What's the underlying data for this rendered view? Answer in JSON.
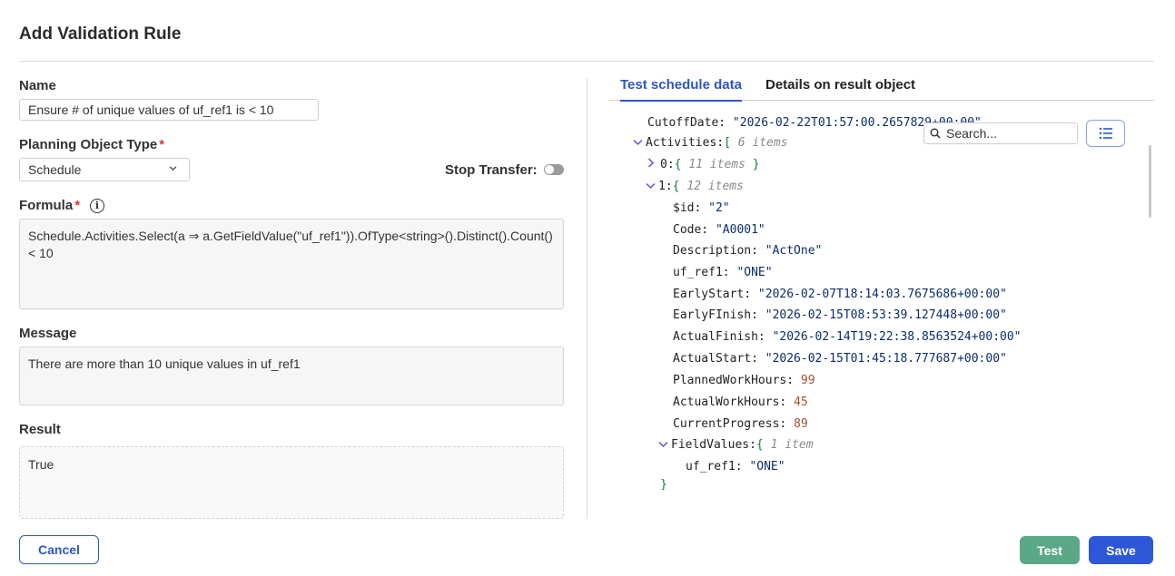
{
  "dialog": {
    "title": "Add Validation Rule"
  },
  "form": {
    "name_label": "Name",
    "name_value": "Ensure # of unique values of uf_ref1 is < 10",
    "planning_object_type_label": "Planning Object Type",
    "required_marker": "*",
    "planning_object_type_value": "Schedule",
    "stop_transfer_label": "Stop Transfer:",
    "stop_transfer_on": false,
    "formula_label": "Formula",
    "formula_value": "Schedule.Activities.Select(a ⇒ a.GetFieldValue(\"uf_ref1\")).OfType<string>().Distinct().Count() < 10",
    "message_label": "Message",
    "message_value": "There are more than 10 unique values in uf_ref1",
    "result_label": "Result",
    "result_value": "True"
  },
  "tabs": [
    {
      "label": "Test schedule data",
      "active": true
    },
    {
      "label": "Details on result object",
      "active": false
    }
  ],
  "search": {
    "placeholder": "Search..."
  },
  "json_tree": {
    "cutoff_key": "CutoffDate:",
    "cutoff_value": "\"2026-02-22T01:57:00.2657829+00:00\"",
    "activities_key": "Activities:",
    "activities_open": "[",
    "activities_count": "6 items",
    "item0_key": "0:",
    "item0_open": "{",
    "item0_count": "11 items",
    "item0_close": "}",
    "item1_key": "1:",
    "item1_open": "{",
    "item1_count": "12 items",
    "fields": [
      {
        "key": "$id:",
        "value": "\"2\"",
        "type": "string"
      },
      {
        "key": "Code:",
        "value": "\"A0001\"",
        "type": "string"
      },
      {
        "key": "Description:",
        "value": "\"ActOne\"",
        "type": "string"
      },
      {
        "key": "uf_ref1:",
        "value": "\"ONE\"",
        "type": "string"
      },
      {
        "key": "EarlyStart:",
        "value": "\"2026-02-07T18:14:03.7675686+00:00\"",
        "type": "string"
      },
      {
        "key": "EarlyFInish:",
        "value": "\"2026-02-15T08:53:39.127448+00:00\"",
        "type": "string"
      },
      {
        "key": "ActualFinish:",
        "value": "\"2026-02-14T19:22:38.8563524+00:00\"",
        "type": "string"
      },
      {
        "key": "ActualStart:",
        "value": "\"2026-02-15T01:45:18.777687+00:00\"",
        "type": "string"
      },
      {
        "key": "PlannedWorkHours:",
        "value": "99",
        "type": "number"
      },
      {
        "key": "ActualWorkHours:",
        "value": "45",
        "type": "number"
      },
      {
        "key": "CurrentProgress:",
        "value": "89",
        "type": "number"
      }
    ],
    "fieldvalues_key": "FieldValues:",
    "fieldvalues_open": "{",
    "fieldvalues_count": "1 item",
    "fv_key": "uf_ref1:",
    "fv_value": "\"ONE\"",
    "close_brace": "}"
  },
  "footer": {
    "cancel_label": "Cancel",
    "test_label": "Test",
    "save_label": "Save"
  },
  "colors": {
    "primary": "#2d57d8",
    "test_button": "#5aa887",
    "required": "#e0323c"
  }
}
